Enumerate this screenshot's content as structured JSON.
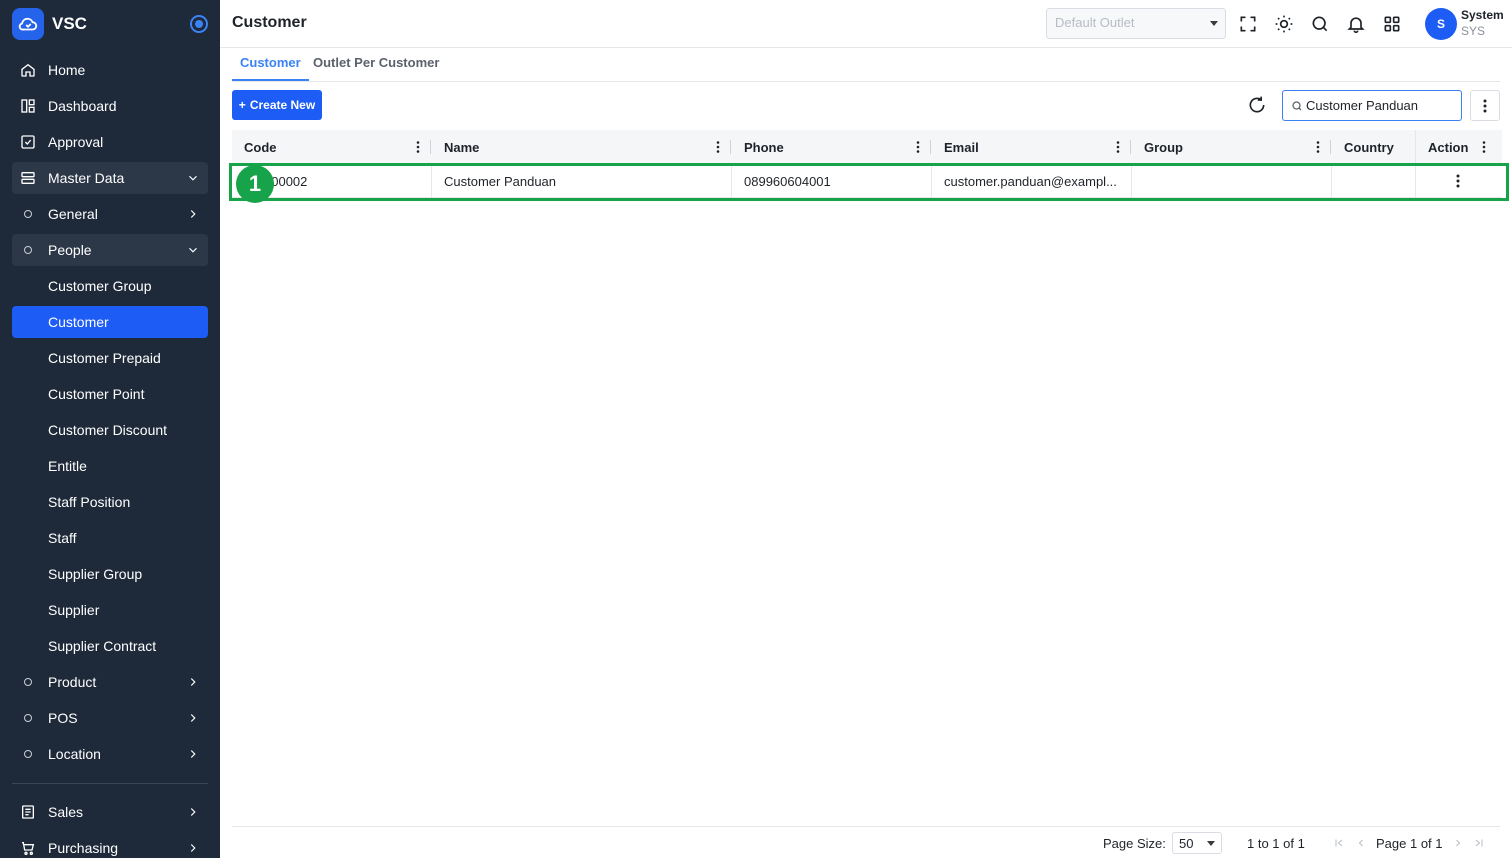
{
  "brand": {
    "name": "VSC"
  },
  "sidebar": {
    "items": [
      {
        "label": "Home"
      },
      {
        "label": "Dashboard"
      },
      {
        "label": "Approval"
      },
      {
        "label": "Master Data"
      },
      {
        "label": "General"
      },
      {
        "label": "People"
      },
      {
        "label": "Customer Group"
      },
      {
        "label": "Customer"
      },
      {
        "label": "Customer Prepaid"
      },
      {
        "label": "Customer Point"
      },
      {
        "label": "Customer Discount"
      },
      {
        "label": "Entitle"
      },
      {
        "label": "Staff Position"
      },
      {
        "label": "Staff"
      },
      {
        "label": "Supplier Group"
      },
      {
        "label": "Supplier"
      },
      {
        "label": "Supplier Contract"
      },
      {
        "label": "Product"
      },
      {
        "label": "POS"
      },
      {
        "label": "Location"
      },
      {
        "label": "Sales"
      },
      {
        "label": "Purchasing"
      }
    ]
  },
  "header": {
    "title": "Customer",
    "outlet_placeholder": "Default Outlet",
    "user_name": "System",
    "user_code": "SYS",
    "avatar_initial": "S"
  },
  "tabs": [
    {
      "label": "Customer"
    },
    {
      "label": "Outlet Per Customer"
    }
  ],
  "toolbar": {
    "create_label": "Create New",
    "search_value": "Customer Panduan"
  },
  "table": {
    "columns": [
      "Code",
      "Name",
      "Phone",
      "Email",
      "Group",
      "Country",
      "Action"
    ],
    "rows": [
      {
        "code": "000002",
        "name": "Customer Panduan",
        "phone": "089960604001",
        "email": "customer.panduan@exampl...",
        "group": "",
        "country": ""
      }
    ]
  },
  "annotation": {
    "step": "1",
    "color": "#17a34a"
  },
  "footer": {
    "page_size_label": "Page Size:",
    "page_size": "50",
    "range_text": "1 to 1 of 1",
    "page_text": "Page 1 of 1"
  },
  "colors": {
    "sidebar_bg": "#1e2939",
    "accent": "#1d5cf5",
    "tab_accent": "#3b82f6"
  }
}
